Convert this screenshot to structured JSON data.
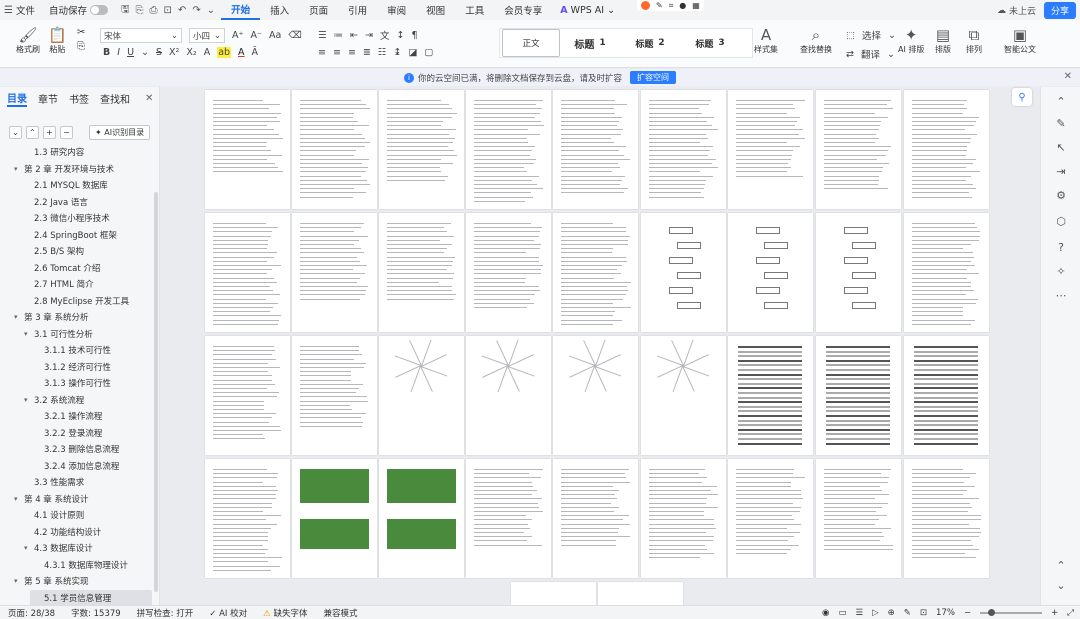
{
  "menubar": {
    "file": "文件",
    "autosave": "自动保存",
    "tabs": [
      "开始",
      "插入",
      "页面",
      "引用",
      "审阅",
      "视图",
      "工具",
      "会员专享"
    ],
    "active_tab": "开始",
    "wps_ai": "WPS AI",
    "cloud": "未上云",
    "share": "分享"
  },
  "ribbon": {
    "format_painter": "格式刷",
    "paste": "粘贴",
    "font_name": "宋体",
    "font_size": "小四",
    "styles": {
      "normal": "正文",
      "h1_label": "标题",
      "h1_num": "1",
      "h2_label": "标题",
      "h2_num": "2",
      "h3_label": "标题",
      "h3_num": "3"
    },
    "style_set": "样式集",
    "find_replace": "查找替换",
    "select": "选择",
    "translate": "翻译",
    "ai_layout": "AI 排版",
    "layout": "排版",
    "arrange": "排列",
    "smart_doc": "智能公文"
  },
  "infobar": {
    "message": "你的云空间已满，将删除文档保存到云盘，请及时扩容",
    "button": "扩容空间"
  },
  "leftpanel": {
    "tabs": [
      "目录",
      "章节",
      "书签",
      "查找和"
    ],
    "ai_toc": "AI识别目录",
    "toc": [
      {
        "label": "1.3 研究内容",
        "level": 2,
        "arrow": ""
      },
      {
        "label": "第 2 章 开发环境与技术",
        "level": 1,
        "arrow": "▾"
      },
      {
        "label": "2.1 MYSQL 数据库",
        "level": 2,
        "arrow": ""
      },
      {
        "label": "2.2 Java 语言",
        "level": 2,
        "arrow": ""
      },
      {
        "label": "2.3 微信小程序技术",
        "level": 2,
        "arrow": ""
      },
      {
        "label": "2.4 SpringBoot 框架",
        "level": 2,
        "arrow": ""
      },
      {
        "label": "2.5 B/S 架构",
        "level": 2,
        "arrow": ""
      },
      {
        "label": "2.6 Tomcat 介绍",
        "level": 2,
        "arrow": ""
      },
      {
        "label": "2.7 HTML 简介",
        "level": 2,
        "arrow": ""
      },
      {
        "label": "2.8 MyEclipse 开发工具",
        "level": 2,
        "arrow": ""
      },
      {
        "label": "第 3 章 系统分析",
        "level": 1,
        "arrow": "▾"
      },
      {
        "label": "3.1 可行性分析",
        "level": 2,
        "arrow": "▾"
      },
      {
        "label": "3.1.1 技术可行性",
        "level": 3,
        "arrow": ""
      },
      {
        "label": "3.1.2 经济可行性",
        "level": 3,
        "arrow": ""
      },
      {
        "label": "3.1.3 操作可行性",
        "level": 3,
        "arrow": ""
      },
      {
        "label": "3.2 系统流程",
        "level": 2,
        "arrow": "▾"
      },
      {
        "label": "3.2.1 操作流程",
        "level": 3,
        "arrow": ""
      },
      {
        "label": "3.2.2 登录流程",
        "level": 3,
        "arrow": ""
      },
      {
        "label": "3.2.3 删除信息流程",
        "level": 3,
        "arrow": ""
      },
      {
        "label": "3.2.4 添加信息流程",
        "level": 3,
        "arrow": ""
      },
      {
        "label": "3.3 性能需求",
        "level": 2,
        "arrow": ""
      },
      {
        "label": "第 4 章 系统设计",
        "level": 1,
        "arrow": "▾"
      },
      {
        "label": "4.1 设计原则",
        "level": 2,
        "arrow": ""
      },
      {
        "label": "4.2 功能结构设计",
        "level": 2,
        "arrow": ""
      },
      {
        "label": "4.3 数据库设计",
        "level": 2,
        "arrow": "▾"
      },
      {
        "label": "4.3.1 数据库物理设计",
        "level": 3,
        "arrow": ""
      },
      {
        "label": "第 5 章 系统实现",
        "level": 1,
        "arrow": "▾"
      },
      {
        "label": "5.1 学员信息管理",
        "level": 3,
        "arrow": "",
        "selected": true
      }
    ]
  },
  "statusbar": {
    "page": "页面: 28/38",
    "words": "字数: 15379",
    "spell": "拼写检查: 打开",
    "ai_check": "AI 校对",
    "missing_font": "缺失字体",
    "mode": "兼容模式",
    "zoom": "17%"
  },
  "accent": "#1f6fe5"
}
